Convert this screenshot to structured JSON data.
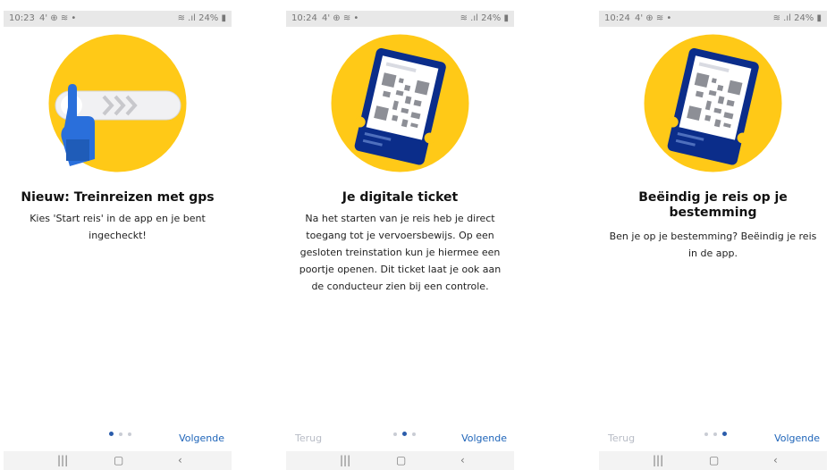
{
  "screens": [
    {
      "status": {
        "time": "10:23",
        "indicators": "4' ⊕ ≋ •",
        "right": "≋ .ıl 24% ▮"
      },
      "title": "Nieuw: Treinreizen met gps",
      "text": "Kies 'Start reis' in de app en je bent ingecheckt!",
      "back_label": "",
      "next_label": "Volgende",
      "active_page": 1,
      "illustration": "swipe-slider-hand-icon"
    },
    {
      "status": {
        "time": "10:24",
        "indicators": "4' ⊕ ≋ •",
        "right": "≋ .ıl 24% ▮"
      },
      "title": "Je digitale ticket",
      "text": "Na het starten van je reis heb je direct toegang tot je vervoersbewijs. Op een gesloten treinstation kun je hiermee een poortje openen. Dit ticket laat je ook aan de conducteur zien bij een controle.",
      "back_label": "Terug",
      "next_label": "Volgende",
      "active_page": 2,
      "illustration": "qr-ticket-icon"
    },
    {
      "status": {
        "time": "10:24",
        "indicators": "4' ⊕ ≋ •",
        "right": "≋ .ıl 24% ▮"
      },
      "title": "Beëindig je reis op je bestemming",
      "text": "Ben je op je bestemming? Beëindig je reis in de app.",
      "back_label": "Terug",
      "next_label": "Volgende",
      "active_page": 3,
      "illustration": "qr-ticket-icon"
    }
  ],
  "colors": {
    "yellow": "#ffc917",
    "ns_blue": "#003082",
    "link_blue": "#1e64b9"
  },
  "nav": {
    "recents": "|||",
    "home": "▢",
    "back": "‹"
  }
}
